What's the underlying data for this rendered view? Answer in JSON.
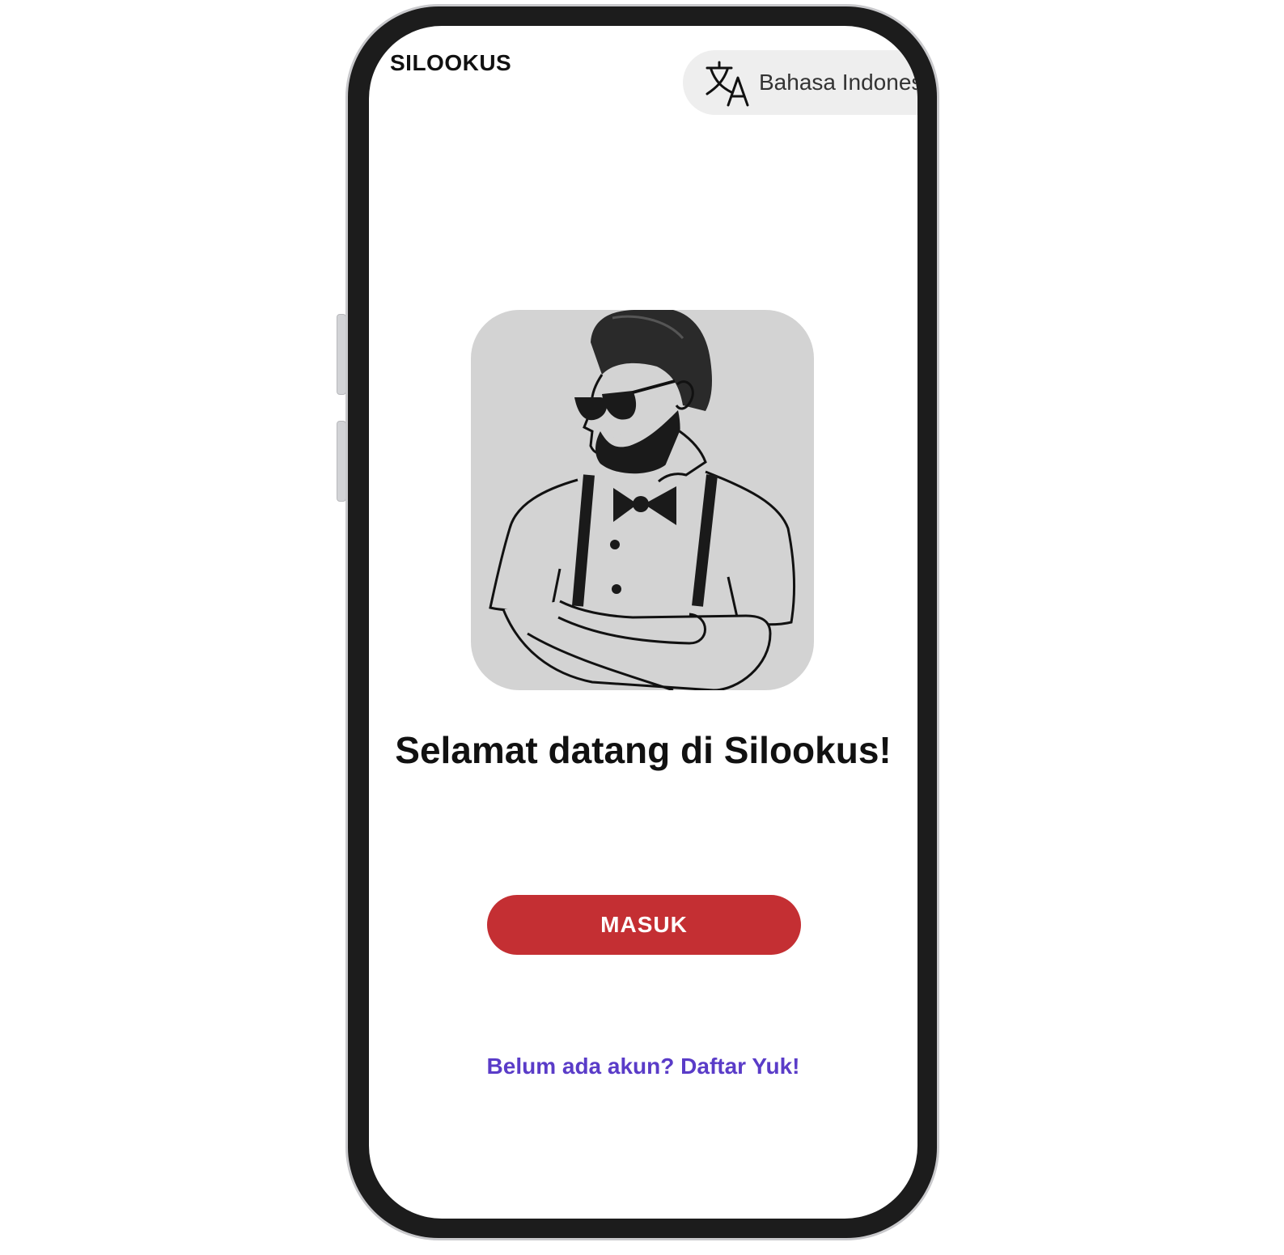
{
  "app": {
    "title": "SILOOKUS"
  },
  "language_selector": {
    "icon": "translate-icon",
    "label": "Bahasa Indonesia"
  },
  "hero": {
    "image": "man-with-sunglasses-bowtie-illustration",
    "background_color": "#d3d3d3"
  },
  "welcome": {
    "headline": "Selamat datang di Silookus!"
  },
  "actions": {
    "login_label": "MASUK",
    "login_color": "#c42f33",
    "signup_link": "Belum ada akun? Daftar Yuk!",
    "signup_color": "#5a3cc8"
  }
}
